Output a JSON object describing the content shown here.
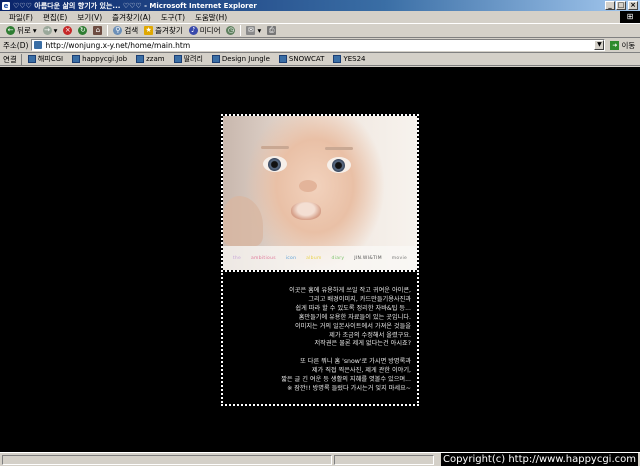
{
  "window": {
    "title": "♡♡♡ 아름다운 삶의 향기가 있는... ♡♡♡ - Microsoft Internet Explorer",
    "controls": [
      "_",
      "□",
      "×"
    ]
  },
  "menu": [
    "파일(F)",
    "편집(E)",
    "보기(V)",
    "즐겨찾기(A)",
    "도구(T)",
    "도움말(H)"
  ],
  "toolbar": {
    "back": "뒤로",
    "search": "검색",
    "favorites": "즐겨찾기",
    "media": "미디어"
  },
  "address": {
    "label": "주소(D)",
    "url": "http://wonjung.x-y.net/home/main.htm",
    "go": "이동"
  },
  "links": {
    "label": "연결",
    "items": [
      "해피CGI",
      "happycgi.Job",
      "zzam",
      "딸려리",
      "Design Jungle",
      "SNOWCAT",
      "YES24"
    ]
  },
  "photo_nav": [
    "the",
    "ambitious",
    "icon",
    "album",
    "diary",
    "JIN.WI&TIM",
    "movie"
  ],
  "description": {
    "paragraph1": [
      "이곳은 홈에 유용하게 쓰일 작고 귀여운 아이콘,",
      "그리고 배경이미지, 카드만들기용사진과",
      "쉽게 따라 할 수 있도록 정리한 자바&팁 등...",
      "홈만들기에 유용한 자료들이 있는 곳입니다.",
      "이미지는 거의 일본사이트에서 가져온 것들을",
      "제가 조금의 수정해서 올렸구요.",
      "저작권은 물론 제게 없다는건 아시죠?"
    ],
    "paragraph2": [
      "또 다른 뭐니 홈 'snow'로 가시면 방명록과",
      "제가 직접 찍은사진, 제게 관한 이야기,",
      "짧은 글 긴 여운 등 생활의 지혜를 엿볼수 있으며...",
      "※ 잠깐!! 방명록 들렀다 가시는거 잊지 마세요~"
    ]
  },
  "status": {
    "copyright": "Copyright(c) http://www.happycgi.com"
  },
  "colors": {
    "page_background": "#000000",
    "titlebar_start": "#0a246a",
    "chrome": "#d4d0c8"
  }
}
